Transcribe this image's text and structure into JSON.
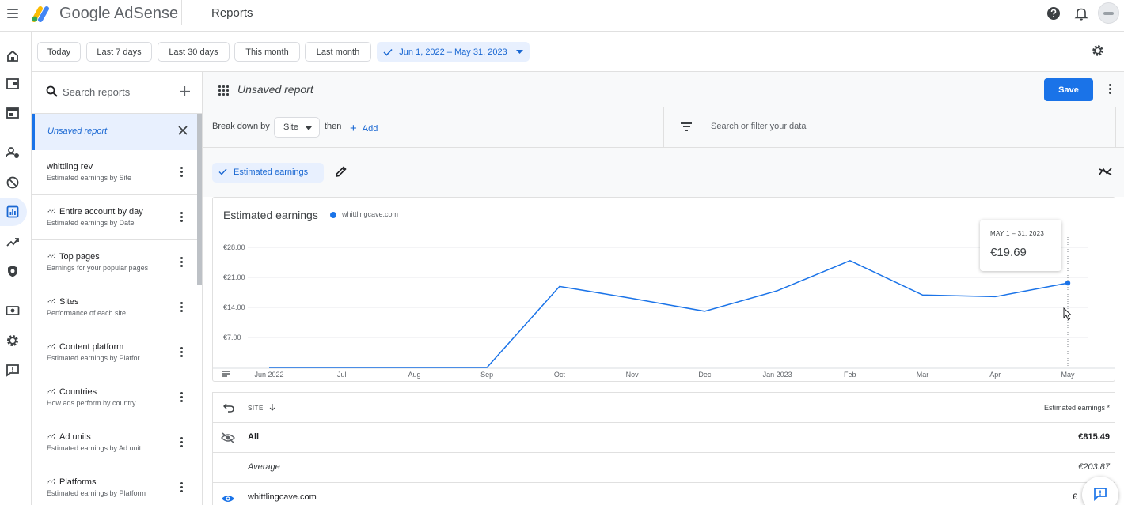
{
  "app": {
    "brand": "Google AdSense",
    "page_title": "Reports"
  },
  "date_ranges": [
    {
      "label": "Today"
    },
    {
      "label": "Last 7 days"
    },
    {
      "label": "Last 30 days"
    },
    {
      "label": "This month"
    },
    {
      "label": "Last month"
    },
    {
      "label": "Jun 1, 2022 – May 31, 2023",
      "selected": true
    }
  ],
  "sidebar": {
    "search_placeholder": "Search reports",
    "current": "Unsaved report",
    "reports": [
      {
        "title": "whittling rev",
        "subtitle": "Estimated earnings by Site",
        "icon": ""
      },
      {
        "title": "Entire account by day",
        "subtitle": "Estimated earnings by Date",
        "icon": "sparkle-icon"
      },
      {
        "title": "Top pages",
        "subtitle": "Earnings for your popular pages",
        "icon": "sparkle-icon"
      },
      {
        "title": "Sites",
        "subtitle": "Performance of each site",
        "icon": "sparkle-icon"
      },
      {
        "title": "Content platform",
        "subtitle": "Estimated earnings by Platfor…",
        "icon": "sparkle-icon"
      },
      {
        "title": "Countries",
        "subtitle": "How ads perform by country",
        "icon": "sparkle-icon"
      },
      {
        "title": "Ad units",
        "subtitle": "Estimated earnings by Ad unit",
        "icon": "sparkle-icon"
      },
      {
        "title": "Platforms",
        "subtitle": "Estimated earnings by Platform",
        "icon": "sparkle-icon"
      }
    ]
  },
  "report": {
    "title": "Unsaved report",
    "save_label": "Save",
    "breakdown_label": "Break down by",
    "breakdown_value": "Site",
    "then_label": "then",
    "add_label": "Add",
    "filter_placeholder": "Search or filter your data",
    "metric_chip": "Estimated earnings"
  },
  "chart_data": {
    "type": "line",
    "title": "Estimated earnings",
    "categories": [
      "Jun 2022",
      "Jul",
      "Aug",
      "Sep",
      "Oct",
      "Nov",
      "Dec",
      "Jan 2023",
      "Feb",
      "Mar",
      "Apr",
      "May"
    ],
    "series": [
      {
        "name": "whittlingcave.com",
        "color": "#1a73e8",
        "values": [
          0,
          0,
          0,
          0,
          18.9,
          16.1,
          13.1,
          17.9,
          24.9,
          16.9,
          16.5,
          19.69
        ]
      }
    ],
    "ylim": [
      0,
      28
    ],
    "yticks": [
      "€28.00",
      "€21.00",
      "€14.00",
      "€7.00"
    ],
    "ytick_values": [
      28,
      21,
      14,
      7
    ],
    "grid": true,
    "tooltip": {
      "date": "MAY 1 – 31, 2023",
      "value": "€19.69",
      "index": 11
    }
  },
  "table": {
    "col_site": "SITE",
    "col_earnings": "Estimated earnings *",
    "rows": [
      {
        "label": "All",
        "value": "€815.49"
      },
      {
        "label": "Average",
        "value": "€203.87"
      },
      {
        "label": "whittlingcave.com",
        "value": "€"
      }
    ]
  },
  "colors": {
    "accent": "#1a73e8",
    "chip_bg": "#e8f0fe"
  }
}
